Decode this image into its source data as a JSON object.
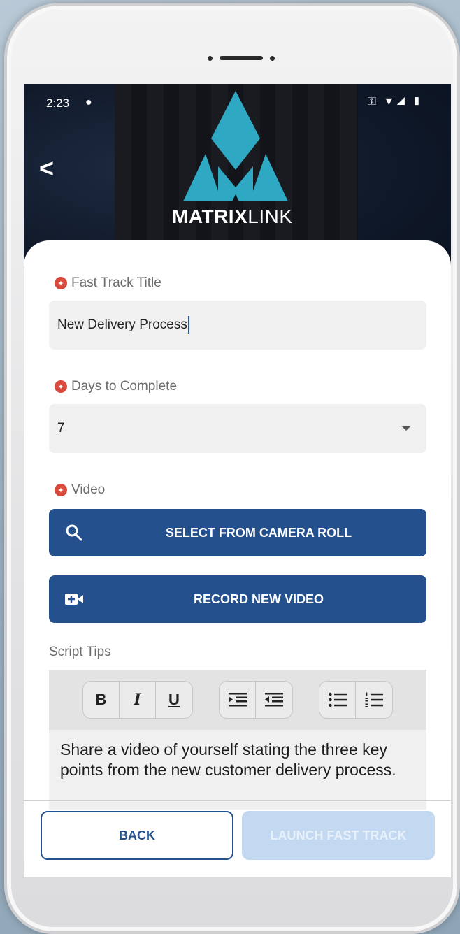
{
  "status_bar": {
    "time": "2:23",
    "notification_icon": "chat-bubble-icon",
    "icons": "⚿ ▼◢ ▮"
  },
  "header": {
    "back_icon": "chevron-left-icon",
    "logo_text_bold": "MATRIX",
    "logo_text_light": "LINK"
  },
  "form": {
    "title_field": {
      "label": "Fast Track Title",
      "value": "New Delivery Process"
    },
    "days_field": {
      "label": "Days to Complete",
      "value": "7"
    },
    "video_field": {
      "label": "Video",
      "camera_roll_button": "SELECT FROM CAMERA ROLL",
      "record_button": "RECORD NEW VIDEO"
    },
    "script_tips": {
      "label": "Script Tips",
      "toolbar": {
        "bold": "B",
        "italic": "I",
        "underline": "U"
      },
      "content": "Share a video of yourself stating the three key points from the new customer delivery process."
    }
  },
  "footer": {
    "back_label": "BACK",
    "launch_label": "LAUNCH FAST TRACK"
  },
  "colors": {
    "primary": "#24508d",
    "required": "#d94a3d",
    "disabled_button": "#c3d8f1",
    "logo_accent": "#2fa8c4"
  }
}
